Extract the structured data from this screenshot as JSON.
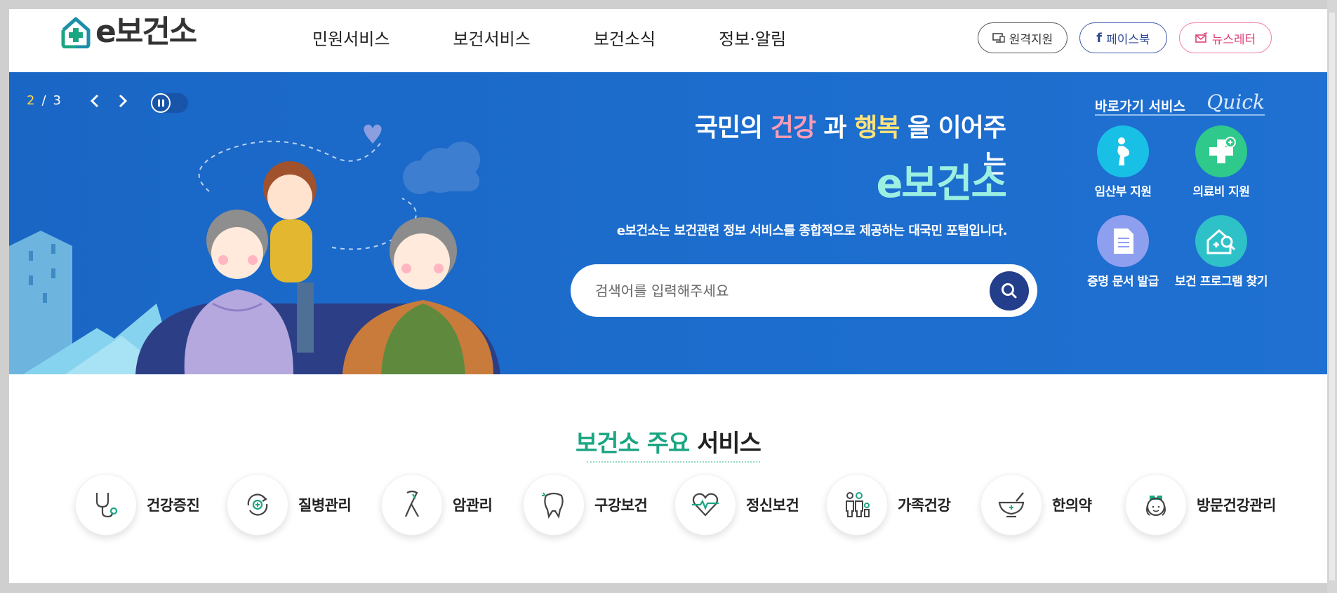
{
  "header": {
    "logo_text": "e보건소",
    "nav": [
      "민원서비스",
      "보건서비스",
      "보건소식",
      "정보·알림"
    ],
    "util": {
      "remote_label": "원격지원",
      "facebook_label": "페이스북",
      "newsletter_label": "뉴스레터"
    }
  },
  "hero": {
    "pager": {
      "current": "2",
      "separator": "/",
      "total": "3"
    },
    "title_before": "국민의 ",
    "title_health": "건강",
    "title_mid": " 과 ",
    "title_happy": "행복",
    "title_after": " 을 이어주는",
    "brand": "e보건소",
    "description": "e보건소는 보건관련 정보 서비스를 종합적으로 제공하는 대국민 포털입니다.",
    "search": {
      "placeholder": "검색어를 입력해주세요"
    }
  },
  "quick": {
    "title": "바로가기 서비스",
    "script": "Quick",
    "items": [
      {
        "label": "임산부 지원",
        "icon": "pregnant-icon",
        "color": "#19c0e6"
      },
      {
        "label": "의료비 지원",
        "icon": "medical-cross-icon",
        "color": "#2ec98b"
      },
      {
        "label": "증명 문서 발급",
        "icon": "document-icon",
        "color": "#8f9ff0"
      },
      {
        "label": "보건 프로그램 찾기",
        "icon": "house-search-icon",
        "color": "#2ec1c8"
      }
    ]
  },
  "services": {
    "title_green": "보건소 주요",
    "title_dark": " 서비스",
    "items": [
      {
        "label": "건강증진",
        "icon": "stethoscope-icon"
      },
      {
        "label": "질병관리",
        "icon": "disease-cycle-icon"
      },
      {
        "label": "암관리",
        "icon": "cancer-ribbon-icon"
      },
      {
        "label": "구강보건",
        "icon": "tooth-icon"
      },
      {
        "label": "정신보건",
        "icon": "heartbeat-icon"
      },
      {
        "label": "가족건강",
        "icon": "family-icon"
      },
      {
        "label": "한의약",
        "icon": "mortar-icon"
      },
      {
        "label": "방문건강관리",
        "icon": "nurse-icon"
      }
    ]
  },
  "colors": {
    "brand_green": "#1ba583",
    "hero_blue": "#1c6dcd",
    "search_button": "#233e8b",
    "facebook": "#3d5ba9",
    "newsletter": "#e0407a"
  }
}
